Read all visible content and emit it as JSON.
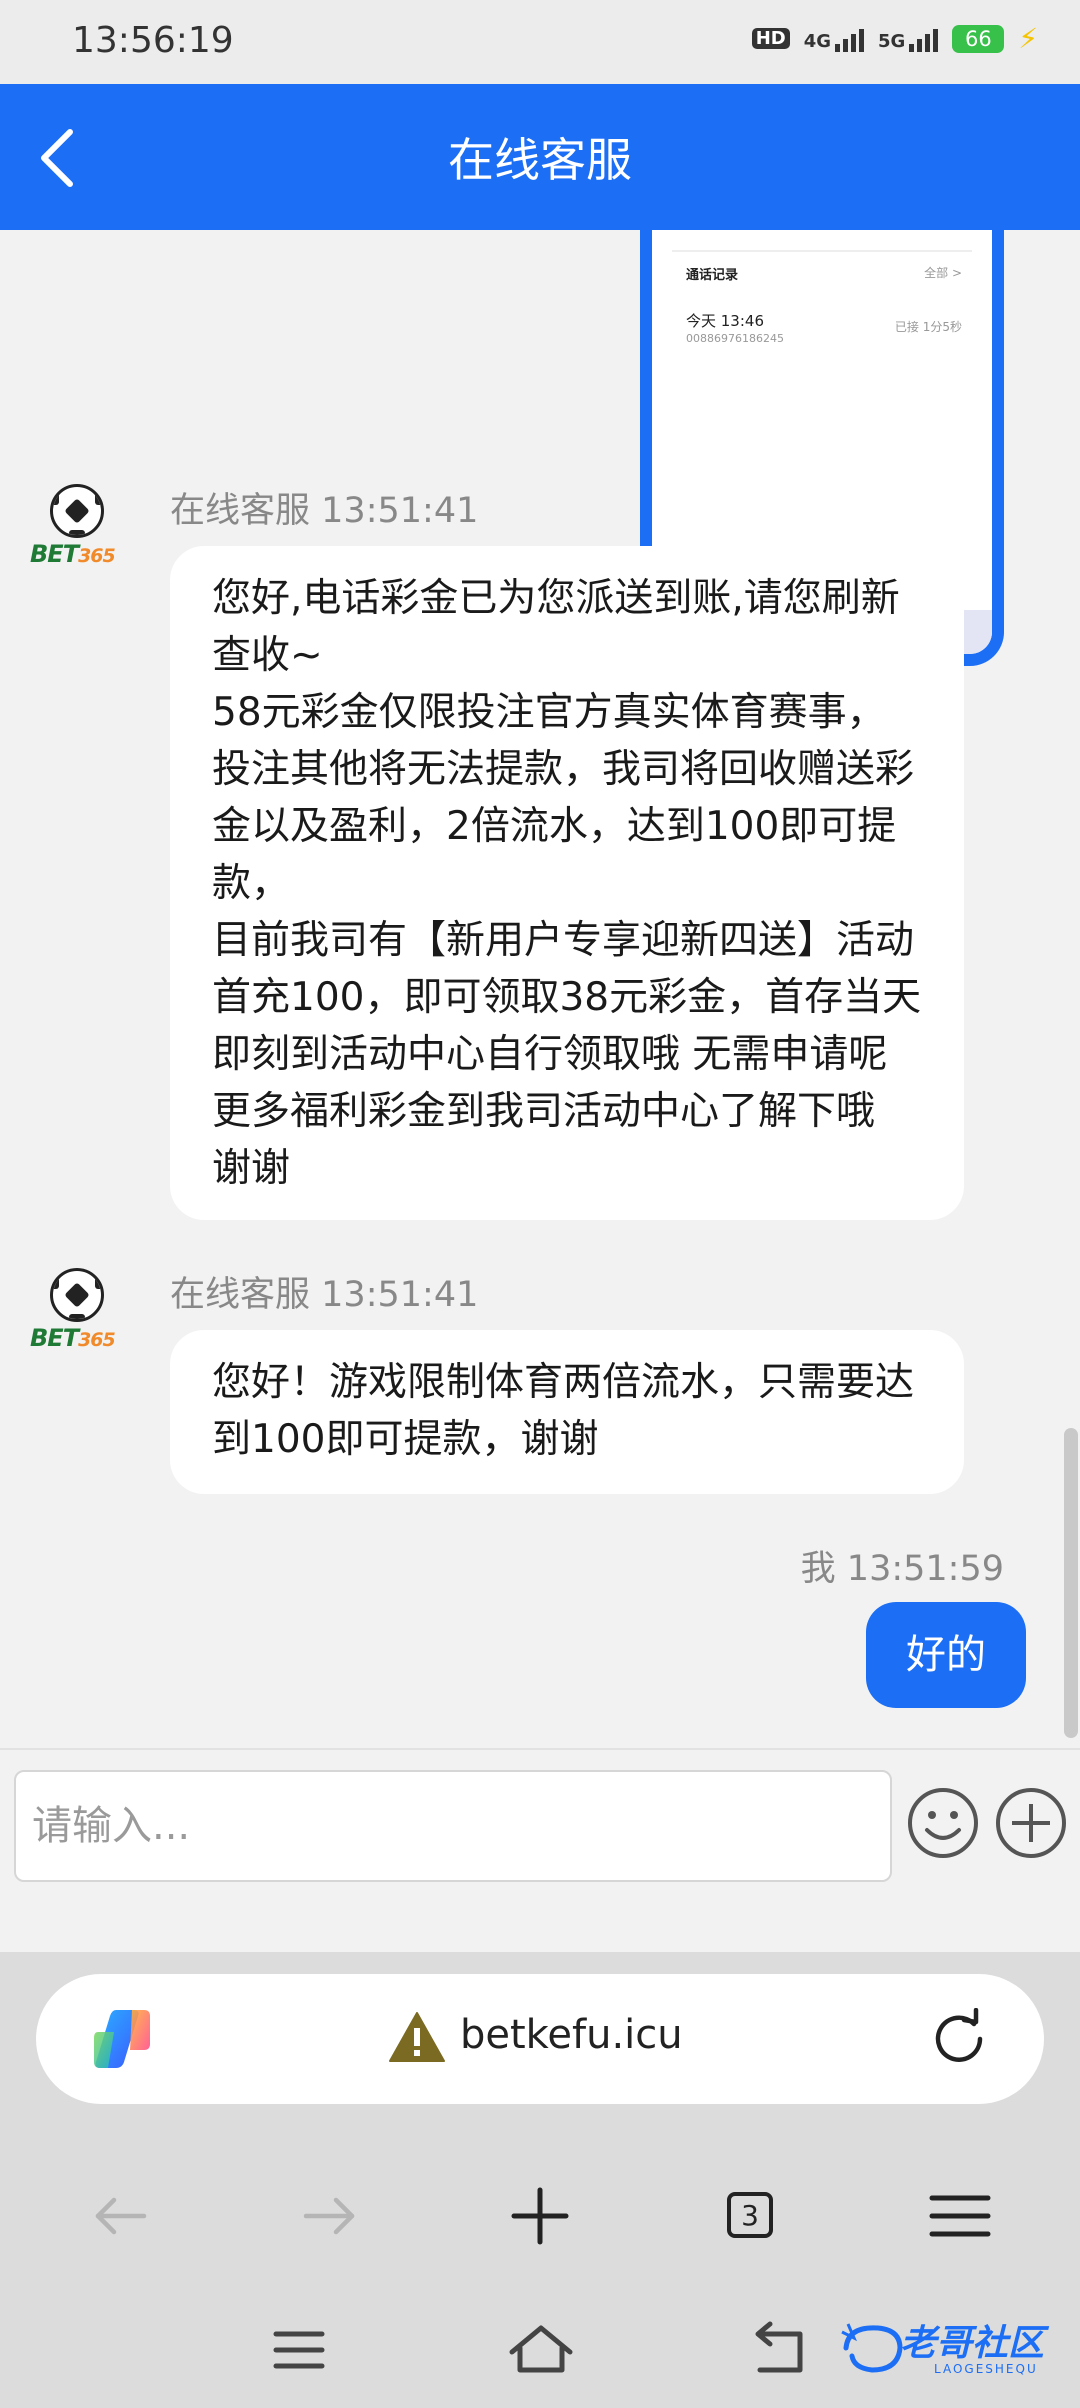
{
  "status": {
    "time": "13:56:19",
    "hd": "HD",
    "sim1_label": "4G",
    "sim2_label": "5G",
    "battery": "66"
  },
  "header": {
    "title": "在线客服"
  },
  "call_screenshot": {
    "section_title": "通话记录",
    "see_all": "全部 >",
    "call_time": "今天 13:46",
    "call_number": "00886976186245",
    "call_duration": "已接 1分5秒"
  },
  "messages": [
    {
      "sender": "在线客服",
      "time": "13:51:41",
      "logo_text": "BET",
      "logo_num": "365",
      "text": "您好,电话彩金已为您派送到账,请您刷新查收~\n58元彩金仅限投注官方真实体育赛事，投注其他将无法提款，我司将回收赠送彩金以及盈利，2倍流水，达到100即可提款，\n目前我司有【新用户专享迎新四送】活动 首充100，即可领取38元彩金，首存当天 即刻到活动中心自行领取哦 无需申请呢 更多福利彩金到我司活动中心了解下哦 谢谢"
    },
    {
      "sender": "在线客服",
      "time": "13:51:41",
      "logo_text": "BET",
      "logo_num": "365",
      "text": "您好！游戏限制体育两倍流水，只需要达到100即可提款，谢谢"
    }
  ],
  "my_message": {
    "sender": "我",
    "time": "13:51:59",
    "text": "好的"
  },
  "input": {
    "placeholder": "请输入..."
  },
  "browser": {
    "url": "betkefu.icu",
    "tab_count": "3"
  },
  "watermark": {
    "text": "老哥社区",
    "sub": "LAOGESHEQU"
  },
  "colors": {
    "accent": "#1c6ef5",
    "bubble_bg": "#ffffff",
    "page_bg": "#f2f2f2"
  }
}
